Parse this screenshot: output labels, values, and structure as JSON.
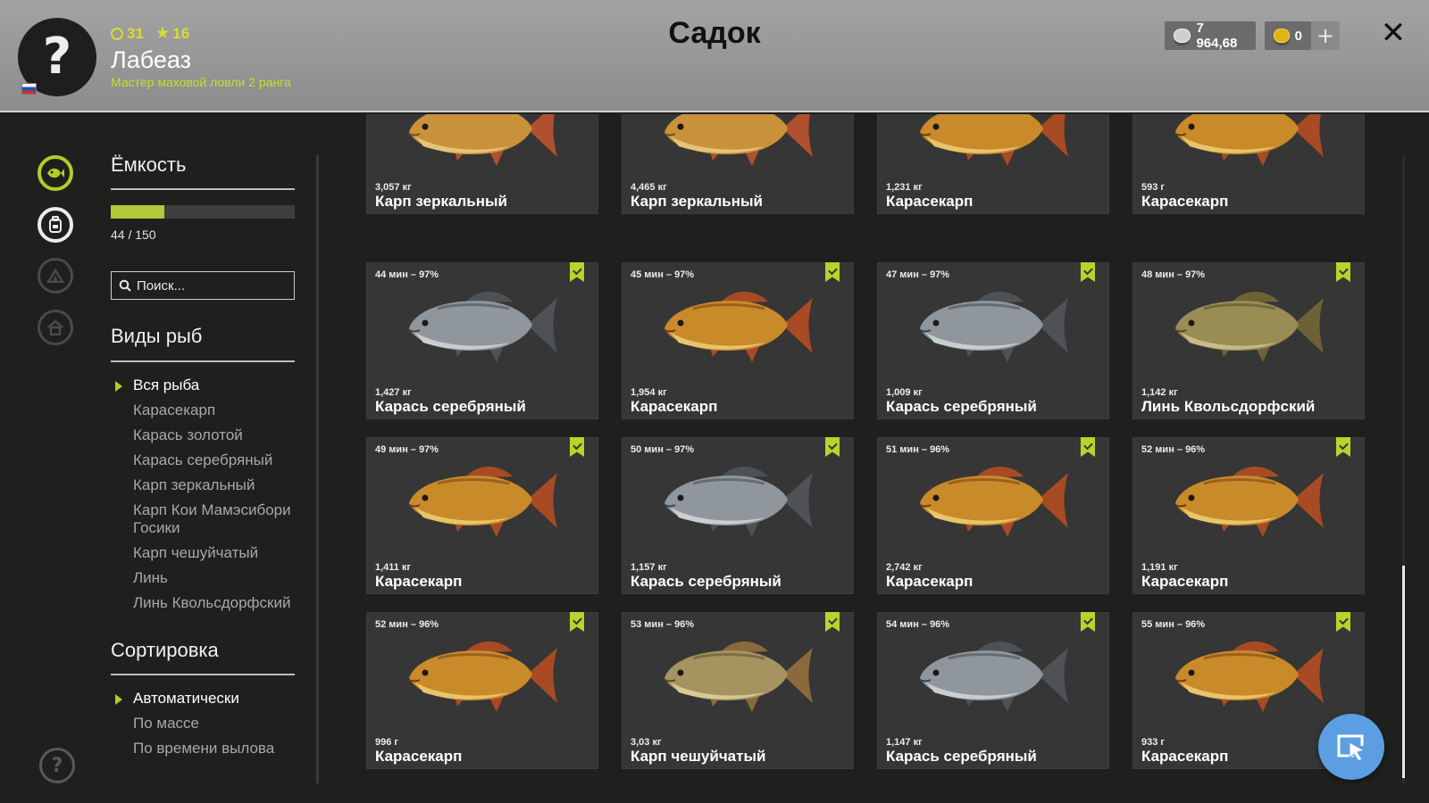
{
  "header": {
    "title": "Садок",
    "player": {
      "name": "Лабеаз",
      "rank_title": "Мастер маховой ловли 2 ранга",
      "level": "31",
      "stars": "16",
      "flag": "russia-flag"
    },
    "currency": {
      "silver": "7 964,68",
      "gold": "0"
    },
    "colors": {
      "accent": "#c9dd2a",
      "header_bg": "#999999"
    }
  },
  "nav": {
    "icons": [
      "fish-keepnet-icon",
      "backpack-icon",
      "camp-icon",
      "home-icon",
      "help-icon"
    ]
  },
  "sidebar": {
    "capacity": {
      "title": "Ёмкость",
      "value": "44 / 150",
      "used": 44,
      "total": 150
    },
    "search": {
      "placeholder": "Поиск..."
    },
    "species": {
      "title": "Виды рыб",
      "items": [
        {
          "label": "Вся рыба",
          "selected": true
        },
        {
          "label": "Карасекарп",
          "selected": false
        },
        {
          "label": "Карась золотой",
          "selected": false
        },
        {
          "label": "Карась серебряный",
          "selected": false
        },
        {
          "label": "Карп зеркальный",
          "selected": false
        },
        {
          "label": "Карп Кои Мамэсибори Госики",
          "selected": false
        },
        {
          "label": "Карп чешуйчатый",
          "selected": false
        },
        {
          "label": "Линь",
          "selected": false
        },
        {
          "label": "Линь Квольсдорфский",
          "selected": false
        }
      ]
    },
    "sort": {
      "title": "Сортировка",
      "items": [
        {
          "label": "Автоматически",
          "selected": true
        },
        {
          "label": "По массе",
          "selected": false
        },
        {
          "label": "По времени вылова",
          "selected": false
        }
      ]
    }
  },
  "fish": [
    {
      "time": "",
      "weight": "3,057 кг",
      "name": "Карп зеркальный",
      "kind": "mirror",
      "bookmark": false
    },
    {
      "time": "",
      "weight": "4,465 кг",
      "name": "Карп зеркальный",
      "kind": "mirror",
      "bookmark": false
    },
    {
      "time": "",
      "weight": "1,231 кг",
      "name": "Карасекарп",
      "kind": "gold",
      "bookmark": false
    },
    {
      "time": "",
      "weight": "593 г",
      "name": "Карасекарп",
      "kind": "gold",
      "bookmark": false
    },
    {
      "time": "44 мин – 97%",
      "weight": "1,427 кг",
      "name": "Карась серебряный",
      "kind": "silver",
      "bookmark": true
    },
    {
      "time": "45 мин – 97%",
      "weight": "1,954 кг",
      "name": "Карасекарп",
      "kind": "gold",
      "bookmark": true
    },
    {
      "time": "47 мин – 97%",
      "weight": "1,009 кг",
      "name": "Карась серебряный",
      "kind": "silver",
      "bookmark": true
    },
    {
      "time": "48 мин – 97%",
      "weight": "1,142 кг",
      "name": "Линь Квольсдорфский",
      "kind": "tench",
      "bookmark": true
    },
    {
      "time": "49 мин – 97%",
      "weight": "1,411 кг",
      "name": "Карасекарп",
      "kind": "gold",
      "bookmark": true
    },
    {
      "time": "50 мин – 97%",
      "weight": "1,157 кг",
      "name": "Карась серебряный",
      "kind": "silver",
      "bookmark": true
    },
    {
      "time": "51 мин – 96%",
      "weight": "2,742 кг",
      "name": "Карасекарп",
      "kind": "gold",
      "bookmark": true
    },
    {
      "time": "52 мин – 96%",
      "weight": "1,191 кг",
      "name": "Карасекарп",
      "kind": "gold",
      "bookmark": true
    },
    {
      "time": "52 мин – 96%",
      "weight": "996 г",
      "name": "Карасекарп",
      "kind": "gold",
      "bookmark": true
    },
    {
      "time": "53 мин – 96%",
      "weight": "3,03 кг",
      "name": "Карп чешуйчатый",
      "kind": "common",
      "bookmark": true
    },
    {
      "time": "54 мин – 96%",
      "weight": "1,147 кг",
      "name": "Карась серебряный",
      "kind": "silver",
      "bookmark": true
    },
    {
      "time": "55 мин – 96%",
      "weight": "933 г",
      "name": "Карасекарп",
      "kind": "gold",
      "bookmark": true
    }
  ]
}
